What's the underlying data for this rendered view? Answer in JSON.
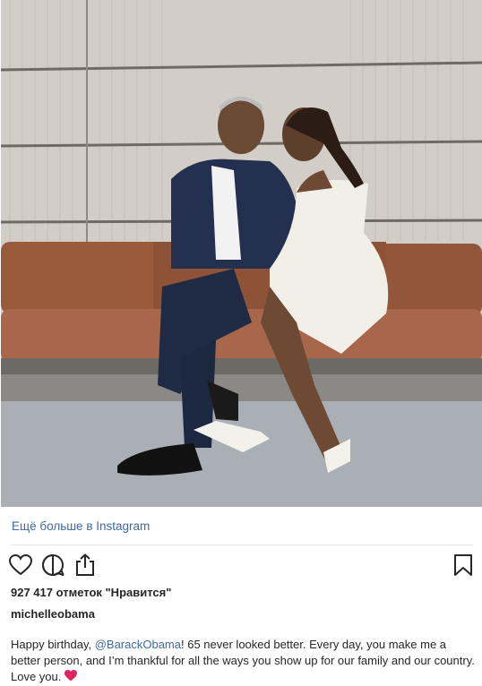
{
  "post": {
    "more_link": "Ещё больше в Instagram",
    "likes_text": "927 417 отметок \"Нравится\"",
    "username": "michelleobama",
    "caption": {
      "before_mention": "Happy birthday, ",
      "mention": "@BarackObama",
      "after_mention": "! 65 never looked better. Every day, you make me a better person, and I’m thankful for all the ways you show up for our family and our country. Love you. "
    },
    "caption_emoji": "red-heart",
    "photo_alt": "photo-of-couple-on-bench"
  },
  "icons": {
    "like": "heart-outline",
    "comment": "speech-bubble",
    "share": "share-upload",
    "save": "bookmark"
  },
  "colors": {
    "link": "#3f6aa3",
    "text": "#262626",
    "heart": "#ed4956",
    "divider": "#e6e6e6"
  }
}
